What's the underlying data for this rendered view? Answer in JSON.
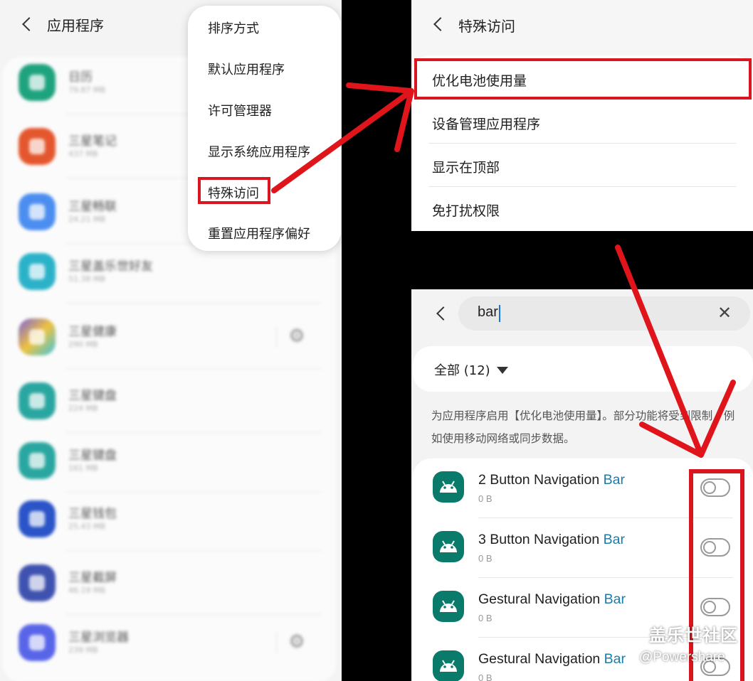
{
  "left": {
    "title": "应用程序",
    "apps": [
      {
        "name": "日历",
        "size": "79.87 MB",
        "color": "#1fa37f",
        "gear": false
      },
      {
        "name": "三星笔记",
        "size": "437 MB",
        "color": "#e4572e",
        "gear": false
      },
      {
        "name": "三星畅联",
        "size": "24.21 MB",
        "color": "#4c8ef0",
        "gear": false
      },
      {
        "name": "三星盖乐世好友",
        "size": "51.38 MB",
        "color": "#2bb2c9",
        "gear": false
      },
      {
        "name": "三星健康",
        "size": "290 MB",
        "color": "#7b61d9",
        "gear": true
      },
      {
        "name": "三星键盘",
        "size": "224 MB",
        "color": "#2aa6a0",
        "gear": false
      },
      {
        "name": "三星键盘",
        "size": "161 MB",
        "color": "#2aa6a0",
        "gear": false
      },
      {
        "name": "三星钱包",
        "size": "25.43 MB",
        "color": "#2a54c7",
        "gear": false
      },
      {
        "name": "三星截屏",
        "size": "46.19 MB",
        "color": "#3f52b0",
        "gear": false
      },
      {
        "name": "三星浏览器",
        "size": "239 MB",
        "color": "#5865e8",
        "gear": true
      }
    ],
    "menu": [
      "排序方式",
      "默认应用程序",
      "许可管理器",
      "显示系统应用程序",
      "特殊访问",
      "重置应用程序偏好"
    ]
  },
  "special": {
    "title": "特殊访问",
    "items": [
      "优化电池使用量",
      "设备管理应用程序",
      "显示在顶部",
      "免打扰权限"
    ]
  },
  "battery": {
    "search_value": "bar",
    "filter_label": "全部 (12)",
    "description": "为应用程序启用【优化电池使用量】。部分功能将受到限制，例如使用移动网络或同步数据。",
    "apps": [
      {
        "name_prefix": "2 Button Navigation ",
        "name_match": "Bar",
        "size": "0 B"
      },
      {
        "name_prefix": "3 Button Navigation ",
        "name_match": "Bar",
        "size": "0 B"
      },
      {
        "name_prefix": "Gestural Navigation ",
        "name_match": "Bar",
        "size": "0 B"
      },
      {
        "name_prefix": "Gestural Navigation ",
        "name_match": "Bar",
        "size": "0 B"
      }
    ]
  },
  "watermark": {
    "line1": "盖乐世社区",
    "line2": "@Powershare"
  },
  "colors": {
    "highlight": "#d9161f",
    "accent": "#1c7ba8",
    "app_icon": "#0a7a6a"
  }
}
